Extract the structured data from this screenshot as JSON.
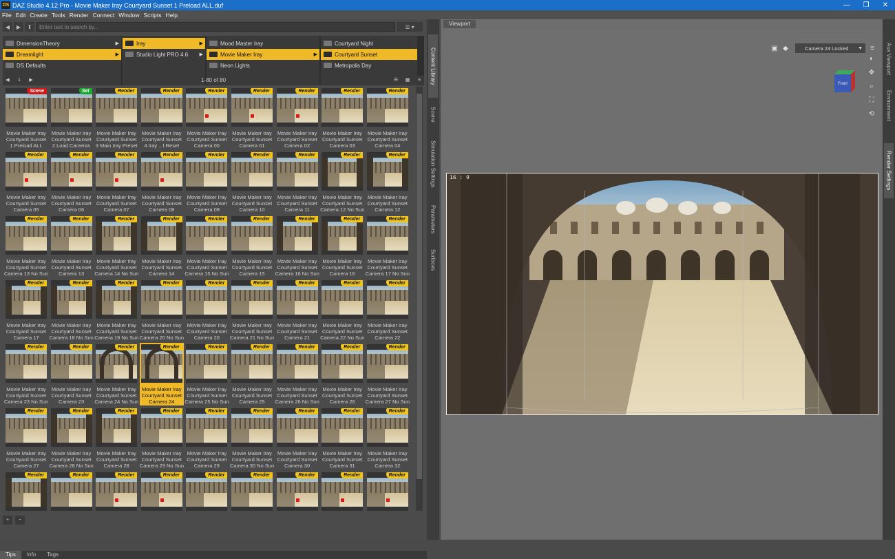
{
  "window": {
    "app_icon": "DS",
    "title": "DAZ Studio 4.12 Pro - Movie Maker Iray Courtyard Sunset 1 Preload ALL.duf",
    "controls": [
      "—",
      "❐",
      "✕"
    ]
  },
  "menu": [
    "File",
    "Edit",
    "Create",
    "Tools",
    "Render",
    "Connect",
    "Window",
    "Scripts",
    "Help"
  ],
  "search": {
    "placeholder": "Enter text to search by..."
  },
  "columns": [
    {
      "items": [
        {
          "label": "DimensionTheory",
          "selected": false,
          "arrow": "▶"
        },
        {
          "label": "Dreamlight",
          "selected": true,
          "arrow": "▶"
        },
        {
          "label": "DS Defaults",
          "selected": false,
          "arrow": ""
        }
      ]
    },
    {
      "items": [
        {
          "label": "Iray",
          "selected": true,
          "arrow": "▶"
        },
        {
          "label": "Studio Light PRO 4.6",
          "selected": false,
          "arrow": "▶"
        }
      ]
    },
    {
      "items": [
        {
          "label": "Mood Master Iray",
          "selected": false,
          "arrow": ""
        },
        {
          "label": "Movie Maker Iray",
          "selected": true,
          "arrow": "▶"
        },
        {
          "label": "Neon Lights",
          "selected": false,
          "arrow": ""
        }
      ]
    },
    {
      "items": [
        {
          "label": "Courtyard Night",
          "selected": false,
          "arrow": ""
        },
        {
          "label": "Courtyard Sunset",
          "selected": true,
          "arrow": ""
        },
        {
          "label": "Metropolis Day",
          "selected": false,
          "arrow": ""
        }
      ]
    }
  ],
  "paging": {
    "page": "1",
    "count": "1-80 of 80"
  },
  "tiles": [
    {
      "badge": "Scene",
      "label": "Movie Maker Iray\nCourtyard Sunset\n1 Preload ALL",
      "variant": "plain"
    },
    {
      "badge": "Set",
      "label": "Movie Maker Iray\nCourtyard Sunset\n2 Load Cameras",
      "variant": "plain"
    },
    {
      "badge": "Render",
      "label": "Movie Maker Iray\nCourtyard Sunset\n3 Main Iray Preset",
      "variant": "plain"
    },
    {
      "badge": "Render",
      "label": "Movie Maker Iray\nCourtyard Sunset\n4 Iray ...t Reset",
      "variant": "plain"
    },
    {
      "badge": "Render",
      "label": "Movie Maker Iray\nCourtyard Sunset\nCamera 00",
      "variant": "dot"
    },
    {
      "badge": "Render",
      "label": "Movie Maker Iray\nCourtyard Sunset\nCamera 01",
      "variant": "dot"
    },
    {
      "badge": "Render",
      "label": "Movie Maker Iray\nCourtyard Sunset\nCamera 02",
      "variant": "dot"
    },
    {
      "badge": "Render",
      "label": "Movie Maker Iray\nCourtyard Sunset\nCamera 03",
      "variant": "plain"
    },
    {
      "badge": "Render",
      "label": "Movie Maker Iray\nCourtyard Sunset\nCamera 04",
      "variant": "plain"
    },
    {
      "badge": "Render",
      "label": "Movie Maker Iray\nCourtyard Sunset\nCamera 05",
      "variant": "dot"
    },
    {
      "badge": "Render",
      "label": "Movie Maker Iray\nCourtyard Sunset\nCamera 06",
      "variant": "dot"
    },
    {
      "badge": "Render",
      "label": "Movie Maker Iray\nCourtyard Sunset\nCamera 07",
      "variant": "dot"
    },
    {
      "badge": "Render",
      "label": "Movie Maker Iray\nCourtyard Sunset\nCamera 08",
      "variant": "dot"
    },
    {
      "badge": "Render",
      "label": "Movie Maker Iray\nCourtyard Sunset\nCamera 09",
      "variant": "plain"
    },
    {
      "badge": "Render",
      "label": "Movie Maker Iray\nCourtyard Sunset\nCamera 10",
      "variant": "plain"
    },
    {
      "badge": "Render",
      "label": "Movie Maker Iray\nCourtyard Sunset\nCamera 11",
      "variant": "plain"
    },
    {
      "badge": "Render",
      "label": "Movie Maker Iray\nCourtyard Sunset\nCamera 12 No Sun",
      "variant": "pillar"
    },
    {
      "badge": "Render",
      "label": "Movie Maker Iray\nCourtyard Sunset\nCamera 12",
      "variant": "pillar"
    },
    {
      "badge": "Render",
      "label": "Movie Maker Iray\nCourtyard Sunset\nCamera 13 No Sun",
      "variant": "plain"
    },
    {
      "badge": "Render",
      "label": "Movie Maker Iray\nCourtyard Sunset\nCamera 13",
      "variant": "plain"
    },
    {
      "badge": "Render",
      "label": "Movie Maker Iray\nCourtyard Sunset\nCamera 14 No Sun",
      "variant": "pillar"
    },
    {
      "badge": "Render",
      "label": "Movie Maker Iray\nCourtyard Sunset\nCamera 14",
      "variant": "pillar"
    },
    {
      "badge": "Render",
      "label": "Movie Maker Iray\nCourtyard Sunset\nCamera 15 No Sun",
      "variant": "plain"
    },
    {
      "badge": "Render",
      "label": "Movie Maker Iray\nCourtyard Sunset\nCamera 15",
      "variant": "plain"
    },
    {
      "badge": "Render",
      "label": "Movie Maker Iray\nCourtyard Sunset\nCamera 16 No Sun",
      "variant": "pillar"
    },
    {
      "badge": "Render",
      "label": "Movie Maker Iray\nCourtyard Sunset\nCamera 16",
      "variant": "pillar"
    },
    {
      "badge": "Render",
      "label": "Movie Maker Iray\nCourtyard Sunset\nCamera 17 No Sun",
      "variant": "plain"
    },
    {
      "badge": "Render",
      "label": "Movie Maker Iray\nCourtyard Sunset\nCamera 17",
      "variant": "pillar"
    },
    {
      "badge": "Render",
      "label": "Movie Maker Iray\nCourtyard Sunset\nCamera 18 No Sun",
      "variant": "pillar"
    },
    {
      "badge": "Render",
      "label": "Movie Maker Iray\nCourtyard Sunset\nCamera 19 No Sun",
      "variant": "pillar"
    },
    {
      "badge": "Render",
      "label": "Movie Maker Iray\nCourtyard Sunset\nCamera 20 No Sun",
      "variant": "plain"
    },
    {
      "badge": "Render",
      "label": "Movie Maker Iray\nCourtyard Sunset\nCamera 20",
      "variant": "plain"
    },
    {
      "badge": "Render",
      "label": "Movie Maker Iray\nCourtyard Sunset\nCamera 21 No Sun",
      "variant": "plain"
    },
    {
      "badge": "Render",
      "label": "Movie Maker Iray\nCourtyard Sunset\nCamera 21",
      "variant": "plain"
    },
    {
      "badge": "Render",
      "label": "Movie Maker Iray\nCourtyard Sunset\nCamera 22 No Sun",
      "variant": "plain"
    },
    {
      "badge": "Render",
      "label": "Movie Maker Iray\nCourtyard Sunset\nCamera 22",
      "variant": "plain"
    },
    {
      "badge": "Render",
      "label": "Movie Maker Iray\nCourtyard Sunset\nCamera 23 No Sun",
      "variant": "plain"
    },
    {
      "badge": "Render",
      "label": "Movie Maker Iray\nCourtyard Sunset\nCamera 23",
      "variant": "plain"
    },
    {
      "badge": "Render",
      "label": "Movie Maker Iray\nCourtyard Sunset\nCamera 24 No Sun",
      "variant": "arch"
    },
    {
      "badge": "Render",
      "label": "Movie Maker Iray\nCourtyard Sunset\nCamera 24",
      "variant": "arch",
      "selected": true
    },
    {
      "badge": "Render",
      "label": "Movie Maker Iray\nCourtyard Sunset\nCamera 25 No Sun",
      "variant": "plain"
    },
    {
      "badge": "Render",
      "label": "Movie Maker Iray\nCourtyard Sunset\nCamera 25",
      "variant": "plain"
    },
    {
      "badge": "Render",
      "label": "Movie Maker Iray\nCourtyard Sunset\nCamera 26 No Sun",
      "variant": "plain"
    },
    {
      "badge": "Render",
      "label": "Movie Maker Iray\nCourtyard Sunset\nCamera 26",
      "variant": "plain"
    },
    {
      "badge": "Render",
      "label": "Movie Maker Iray\nCourtyard Sunset\nCamera 27 No Sun",
      "variant": "plain"
    },
    {
      "badge": "Render",
      "label": "Movie Maker Iray\nCourtyard Sunset\nCamera 27",
      "variant": "plain"
    },
    {
      "badge": "Render",
      "label": "Movie Maker Iray\nCourtyard Sunset\nCamera 28 No Sun",
      "variant": "pillar"
    },
    {
      "badge": "Render",
      "label": "Movie Maker Iray\nCourtyard Sunset\nCamera 28",
      "variant": "pillar"
    },
    {
      "badge": "Render",
      "label": "Movie Maker Iray\nCourtyard Sunset\nCamera 29 No Sun",
      "variant": "plain"
    },
    {
      "badge": "Render",
      "label": "Movie Maker Iray\nCourtyard Sunset\nCamera 29",
      "variant": "plain"
    },
    {
      "badge": "Render",
      "label": "Movie Maker Iray\nCourtyard Sunset\nCamera 30 No Sun",
      "variant": "plain"
    },
    {
      "badge": "Render",
      "label": "Movie Maker Iray\nCourtyard Sunset\nCamera 30",
      "variant": "plain"
    },
    {
      "badge": "Render",
      "label": "Movie Maker Iray\nCourtyard Sunset\nCamera 31",
      "variant": "plain"
    },
    {
      "badge": "Render",
      "label": "Movie Maker Iray\nCourtyard Sunset\nCamera 32",
      "variant": "plain"
    },
    {
      "badge": "Render",
      "label": "",
      "variant": "pillar"
    },
    {
      "badge": "Render",
      "label": "",
      "variant": "plain"
    },
    {
      "badge": "Render",
      "label": "",
      "variant": "dot"
    },
    {
      "badge": "Render",
      "label": "",
      "variant": "dot"
    },
    {
      "badge": "Render",
      "label": "",
      "variant": "plain"
    },
    {
      "badge": "Render",
      "label": "",
      "variant": "plain"
    },
    {
      "badge": "Render",
      "label": "",
      "variant": "dot"
    },
    {
      "badge": "Render",
      "label": "",
      "variant": "dot"
    },
    {
      "badge": "Render",
      "label": "",
      "variant": "dot"
    }
  ],
  "bottom_tabs": [
    "Tips",
    "Info",
    "Tags"
  ],
  "left_side_tabs": [
    "Content Library",
    "Scene",
    "Simulation Settings",
    "Parameters",
    "Surfaces"
  ],
  "right_side_tabs": [
    "Aux Viewport",
    "Environment",
    "Render Settings"
  ],
  "viewport": {
    "tab": "Viewport",
    "camera": "Camera 24 Locked",
    "aspect_label": "16 : 9",
    "cube_label": "Front"
  },
  "colors": {
    "accent": "#f0b928",
    "titlebar": "#1b6fc8",
    "badge_render": "#f2c418",
    "badge_scene": "#d01818",
    "badge_set": "#18a830"
  }
}
